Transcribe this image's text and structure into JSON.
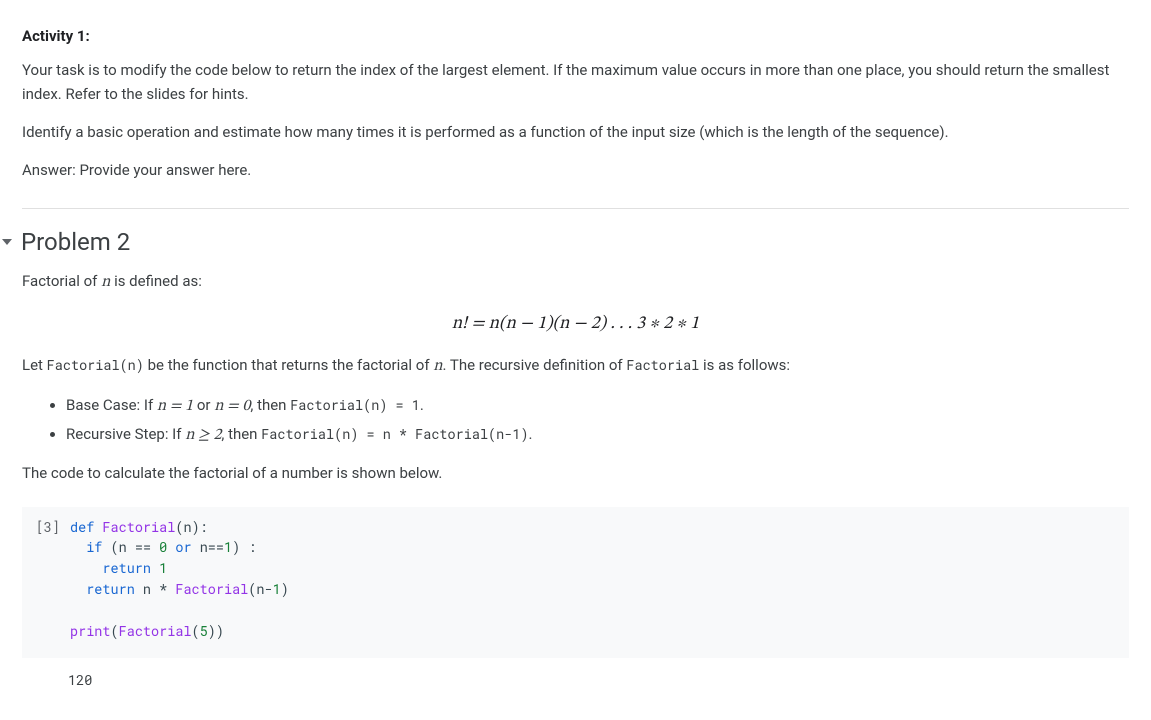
{
  "activity1": {
    "heading": "Activity 1:",
    "p1": "Your task is to modify the code below to return the index of the largest element. If the maximum value occurs in more than one place, you should return the smallest index. Refer to the slides for hints.",
    "p2": "Identify a basic operation and estimate how many times it is performed as a function of the input size (which is the length of the sequence).",
    "p3": "Answer: Provide your answer here."
  },
  "problem2": {
    "title": "Problem 2",
    "intro_prefix": "Factorial of ",
    "intro_var": "n",
    "intro_suffix": " is defined as:",
    "formula_lhs": "n! = ",
    "formula_rhs": "n(n − 1)(n − 2) . . . 3 ∗ 2 ∗ 1",
    "let_p1": "Let ",
    "let_code1": "Factorial(n)",
    "let_p2": " be the function that returns the factorial of ",
    "let_var": "n",
    "let_p3": ". The recursive definition of ",
    "let_code2": "Factorial",
    "let_p4": " is as follows:",
    "base_prefix": "Base Case: If ",
    "base_math": "n = 1",
    "base_or": " or ",
    "base_math2": "n = 0",
    "base_then": ", then ",
    "base_code": "Factorial(n) = 1",
    "base_period": ".",
    "rec_prefix": "Recursive Step: If ",
    "rec_math": "n ≥ 2",
    "rec_then": ", then ",
    "rec_code": "Factorial(n) = n * Factorial(n-1)",
    "rec_period": ".",
    "closing": "The code to calculate the factorial of a number is shown below."
  },
  "code_cell": {
    "exec_count": "[3]",
    "tokens": {
      "def": "def",
      "fname": "Factorial",
      "lp": "(",
      "n": "n",
      "rp": ")",
      "colon": ":",
      "if": "if",
      "eq": "==",
      "zero": "0",
      "or": "or",
      "one": "1",
      "return": "return",
      "star": "*",
      "minus": "-",
      "print": "print",
      "five": "5"
    },
    "output": "120"
  }
}
